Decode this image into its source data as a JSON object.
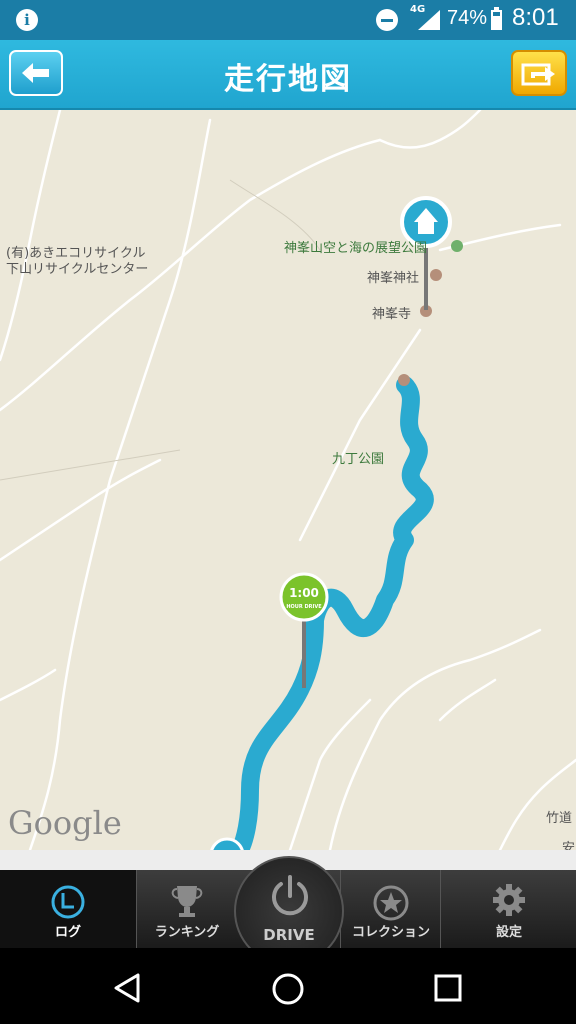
{
  "status_bar": {
    "network": "4G",
    "battery_percent": "74%",
    "time": "8:01",
    "info_icon": "info-icon"
  },
  "header": {
    "title": "走行地図",
    "back_icon": "back-arrow-icon",
    "share_icon": "share-icon"
  },
  "map": {
    "labels": {
      "recycle_1": "(有)あきエコリサイクル",
      "recycle_2": "下山リサイクルセンター",
      "park_observatory": "神峯山空と海の展望公園",
      "shrine": "神峯神社",
      "temple": "神峯寺",
      "kuchou_park": "九丁公園",
      "chikudou": "竹道",
      "an": "安"
    },
    "milestone": {
      "value": "1:00",
      "caption": "HOUR DRIVE"
    },
    "attribution": "Google",
    "route_color": "#2aaad0"
  },
  "tabs": [
    {
      "label": "ログ",
      "icon": "clock-icon",
      "active": true
    },
    {
      "label": "ランキング",
      "icon": "trophy-icon",
      "active": false
    },
    {
      "label": "DRIVE",
      "icon": "power-icon",
      "active": false
    },
    {
      "label": "コレクション",
      "icon": "star-badge-icon",
      "active": false
    },
    {
      "label": "設定",
      "icon": "gear-icon",
      "active": false
    }
  ],
  "navigation": {
    "back": "nav-back-icon",
    "home": "nav-home-icon",
    "recents": "nav-recents-icon"
  }
}
